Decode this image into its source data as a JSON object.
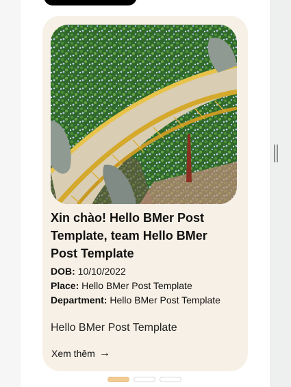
{
  "card": {
    "title": "Xin chào! Hello BMer Post Template, team Hello BMer Post Template",
    "dob_label": "DOB:",
    "dob_value": "10/10/2022",
    "place_label": "Place:",
    "place_value": "Hello BMer Post Template",
    "department_label": "Department:",
    "department_value": "Hello BMer Post Template",
    "description": "Hello BMer Post Template",
    "read_more_label": "Xem thêm",
    "read_more_icon": "arrow-right-icon"
  },
  "pagination": {
    "total_dots": 3,
    "active_index": 0,
    "active_color": "#f2cb93"
  }
}
